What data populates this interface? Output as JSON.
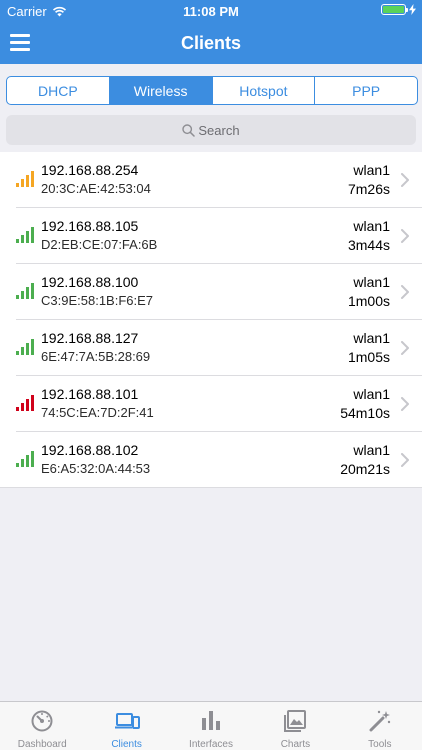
{
  "status_bar": {
    "carrier": "Carrier",
    "time": "11:08 PM"
  },
  "nav": {
    "title": "Clients",
    "menu_icon": "hamburger-menu-icon"
  },
  "segments": [
    {
      "label": "DHCP",
      "active": false
    },
    {
      "label": "Wireless",
      "active": true
    },
    {
      "label": "Hotspot",
      "active": false
    },
    {
      "label": "PPP",
      "active": false
    }
  ],
  "search": {
    "placeholder": "Search",
    "icon": "search-icon"
  },
  "clients": [
    {
      "ip": "192.168.88.254",
      "mac": "20:3C:AE:42:53:04",
      "interface": "wlan1",
      "uptime": "7m26s",
      "signal_color": "#f5a623"
    },
    {
      "ip": "192.168.88.105",
      "mac": "D2:EB:CE:07:FA:6B",
      "interface": "wlan1",
      "uptime": "3m44s",
      "signal_color": "#4cae4f"
    },
    {
      "ip": "192.168.88.100",
      "mac": "C3:9E:58:1B:F6:E7",
      "interface": "wlan1",
      "uptime": "1m00s",
      "signal_color": "#4cae4f"
    },
    {
      "ip": "192.168.88.127",
      "mac": "6E:47:7A:5B:28:69",
      "interface": "wlan1",
      "uptime": "1m05s",
      "signal_color": "#4cae4f"
    },
    {
      "ip": "192.168.88.101",
      "mac": "74:5C:EA:7D:2F:41",
      "interface": "wlan1",
      "uptime": "54m10s",
      "signal_color": "#d0021b"
    },
    {
      "ip": "192.168.88.102",
      "mac": "E6:A5:32:0A:44:53",
      "interface": "wlan1",
      "uptime": "20m21s",
      "signal_color": "#4cae4f"
    }
  ],
  "tabs": [
    {
      "label": "Dashboard",
      "icon": "dashboard-gauge-icon",
      "active": false
    },
    {
      "label": "Clients",
      "icon": "devices-icon",
      "active": true
    },
    {
      "label": "Interfaces",
      "icon": "bar-chart-icon",
      "active": false
    },
    {
      "label": "Charts",
      "icon": "charts-gallery-icon",
      "active": false
    },
    {
      "label": "Tools",
      "icon": "magic-wand-icon",
      "active": false
    }
  ],
  "colors": {
    "accent": "#3c8de0",
    "background": "#efeff4"
  }
}
